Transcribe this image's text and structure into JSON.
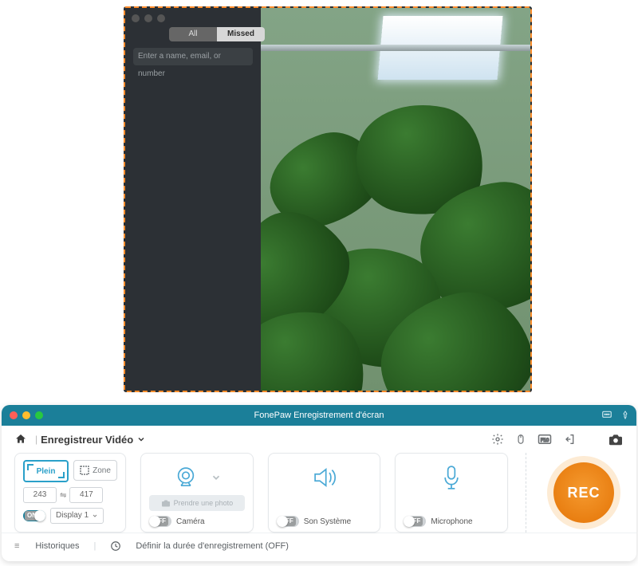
{
  "capture": {
    "tabs": {
      "all": "All",
      "missed": "Missed"
    },
    "search_placeholder": "Enter a name, email, or number"
  },
  "panel": {
    "title": "FonePaw Enregistrement d'écran",
    "breadcrumb": "Enregistreur Vidéo",
    "screen": {
      "mode_full": "Plein",
      "mode_zone": "Zone",
      "width": "243",
      "height": "417",
      "display_toggle": "ON",
      "display_label": "Display 1"
    },
    "camera": {
      "take_photo": "Prendre une photo",
      "toggle": "OFF",
      "label": "Caméra"
    },
    "system_sound": {
      "toggle": "OFF",
      "label": "Son Système"
    },
    "microphone": {
      "toggle": "OFF",
      "label": "Microphone"
    },
    "rec_label": "REC",
    "footer": {
      "history": "Historiques",
      "timer": "Définir la durée d'enregistrement (OFF)"
    }
  }
}
